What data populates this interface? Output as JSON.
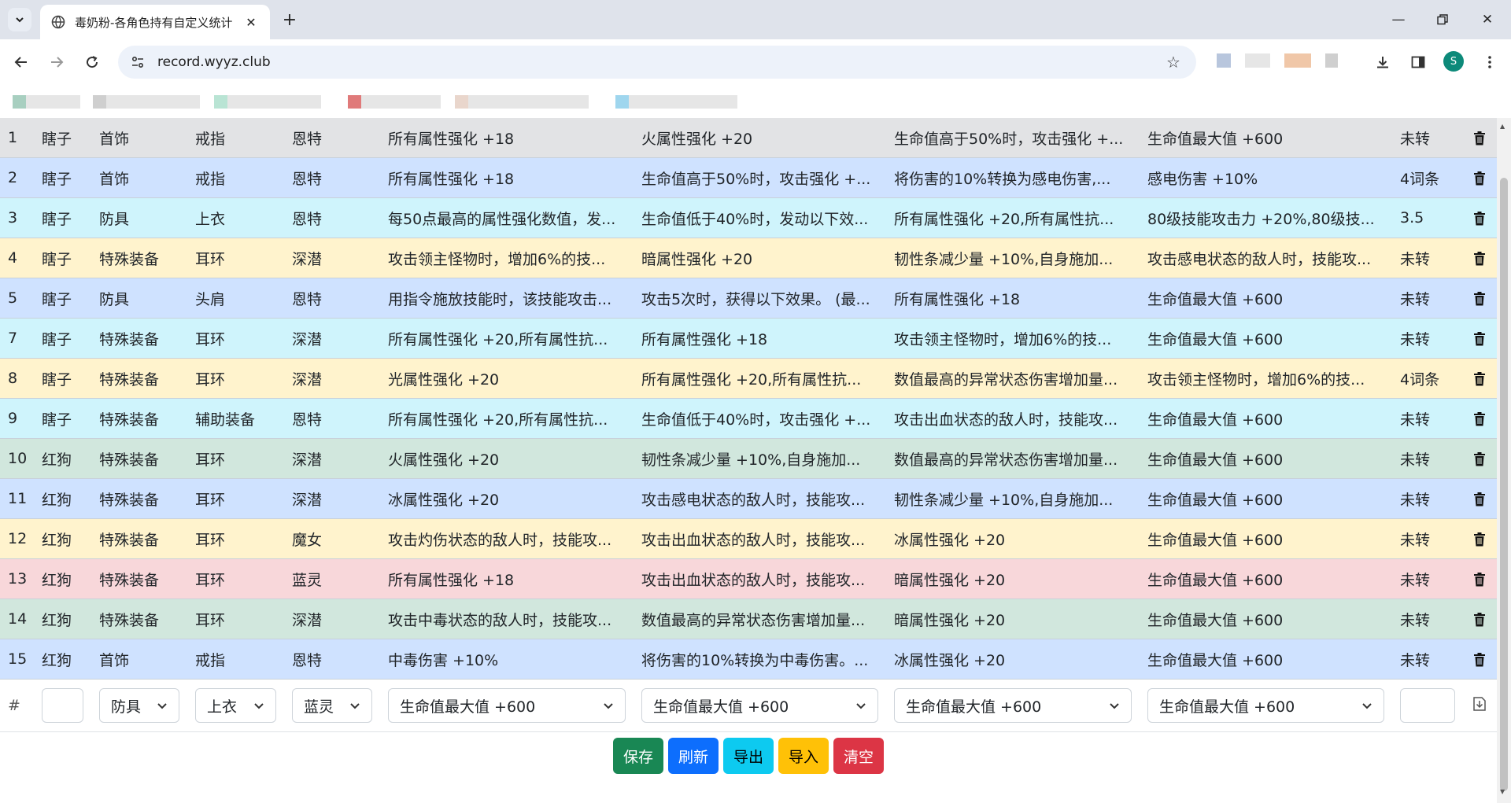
{
  "browser": {
    "tab_title": "毒奶粉-各角色持有自定义统计",
    "url": "record.wyyz.club",
    "profile_initial": "S"
  },
  "colors": {
    "gray": "#e2e3e5",
    "blue": "#cfe2ff",
    "cyan": "#cff4fc",
    "yellow": "#fff3cd",
    "green": "#d1e7dd",
    "red": "#f8d7da",
    "btn_save": "#198754",
    "btn_refresh": "#0d6efd",
    "btn_export": "#0dcaf0",
    "btn_import": "#ffc107",
    "btn_clear": "#dc3545"
  },
  "table": {
    "rows": [
      {
        "id": "1",
        "role": "瞎子",
        "type": "首饰",
        "slot": "戒指",
        "set": "恩特",
        "a1": "所有属性强化 +18",
        "a2": "火属性强化 +20",
        "a3": "生命值高于50%时，攻击强化 +...",
        "a4": "生命值最大值 +600",
        "status": "未转",
        "color": "gray"
      },
      {
        "id": "2",
        "role": "瞎子",
        "type": "首饰",
        "slot": "戒指",
        "set": "恩特",
        "a1": "所有属性强化 +18",
        "a2": "生命值高于50%时，攻击强化 +...",
        "a3": "将伤害的10%转换为感电伤害,...",
        "a4": "感电伤害 +10%",
        "status": "4词条",
        "color": "blue"
      },
      {
        "id": "3",
        "role": "瞎子",
        "type": "防具",
        "slot": "上衣",
        "set": "恩特",
        "a1": "每50点最高的属性强化数值，发...",
        "a2": "生命值低于40%时，发动以下效...",
        "a3": "所有属性强化 +20,所有属性抗...",
        "a4": "80级技能攻击力 +20%,80级技...",
        "status": "3.5",
        "color": "cyan"
      },
      {
        "id": "4",
        "role": "瞎子",
        "type": "特殊装备",
        "slot": "耳环",
        "set": "深潜",
        "a1": "攻击领主怪物时，增加6%的技...",
        "a2": "暗属性强化 +20",
        "a3": "韧性条减少量 +10%,自身施加...",
        "a4": "攻击感电状态的敌人时，技能攻...",
        "status": "未转",
        "color": "yellow"
      },
      {
        "id": "5",
        "role": "瞎子",
        "type": "防具",
        "slot": "头肩",
        "set": "恩特",
        "a1": "用指令施放技能时，该技能攻击...",
        "a2": "攻击5次时，获得以下效果。 (最...",
        "a3": "所有属性强化 +18",
        "a4": "生命值最大值 +600",
        "status": "未转",
        "color": "blue"
      },
      {
        "id": "7",
        "role": "瞎子",
        "type": "特殊装备",
        "slot": "耳环",
        "set": "深潜",
        "a1": "所有属性强化 +20,所有属性抗...",
        "a2": "所有属性强化 +18",
        "a3": "攻击领主怪物时，增加6%的技...",
        "a4": "生命值最大值 +600",
        "status": "未转",
        "color": "cyan"
      },
      {
        "id": "8",
        "role": "瞎子",
        "type": "特殊装备",
        "slot": "耳环",
        "set": "深潜",
        "a1": "光属性强化 +20",
        "a2": "所有属性强化 +20,所有属性抗...",
        "a3": "数值最高的异常状态伤害增加量...",
        "a4": "攻击领主怪物时，增加6%的技...",
        "status": "4词条",
        "color": "yellow"
      },
      {
        "id": "9",
        "role": "瞎子",
        "type": "特殊装备",
        "slot": "辅助装备",
        "set": "恩特",
        "a1": "所有属性强化 +20,所有属性抗...",
        "a2": "生命值低于40%时，攻击强化 +...",
        "a3": "攻击出血状态的敌人时，技能攻...",
        "a4": "生命值最大值 +600",
        "status": "未转",
        "color": "cyan"
      },
      {
        "id": "10",
        "role": "红狗",
        "type": "特殊装备",
        "slot": "耳环",
        "set": "深潜",
        "a1": "火属性强化 +20",
        "a2": "韧性条减少量 +10%,自身施加...",
        "a3": "数值最高的异常状态伤害增加量...",
        "a4": "生命值最大值 +600",
        "status": "未转",
        "color": "green"
      },
      {
        "id": "11",
        "role": "红狗",
        "type": "特殊装备",
        "slot": "耳环",
        "set": "深潜",
        "a1": "冰属性强化 +20",
        "a2": "攻击感电状态的敌人时，技能攻...",
        "a3": "韧性条减少量 +10%,自身施加...",
        "a4": "生命值最大值 +600",
        "status": "未转",
        "color": "blue"
      },
      {
        "id": "12",
        "role": "红狗",
        "type": "特殊装备",
        "slot": "耳环",
        "set": "魔女",
        "a1": "攻击灼伤状态的敌人时，技能攻...",
        "a2": "攻击出血状态的敌人时，技能攻...",
        "a3": "冰属性强化 +20",
        "a4": "生命值最大值 +600",
        "status": "未转",
        "color": "yellow"
      },
      {
        "id": "13",
        "role": "红狗",
        "type": "特殊装备",
        "slot": "耳环",
        "set": "蓝灵",
        "a1": "所有属性强化 +18",
        "a2": "攻击出血状态的敌人时，技能攻...",
        "a3": "暗属性强化 +20",
        "a4": "生命值最大值 +600",
        "status": "未转",
        "color": "red"
      },
      {
        "id": "14",
        "role": "红狗",
        "type": "特殊装备",
        "slot": "耳环",
        "set": "深潜",
        "a1": "攻击中毒状态的敌人时，技能攻...",
        "a2": "数值最高的异常状态伤害增加量...",
        "a3": "暗属性强化 +20",
        "a4": "生命值最大值 +600",
        "status": "未转",
        "color": "green"
      },
      {
        "id": "15",
        "role": "红狗",
        "type": "首饰",
        "slot": "戒指",
        "set": "恩特",
        "a1": "中毒伤害 +10%",
        "a2": "将伤害的10%转换为中毒伤害。...",
        "a3": "冰属性强化 +20",
        "a4": "生命值最大值 +600",
        "status": "未转",
        "color": "blue"
      }
    ]
  },
  "form": {
    "hash": "#",
    "type": "防具",
    "slot": "上衣",
    "set": "蓝灵",
    "a1": "生命值最大值 +600",
    "a2": "生命值最大值 +600",
    "a3": "生命值最大值 +600",
    "a4": "生命值最大值 +600"
  },
  "buttons": {
    "save": "保存",
    "refresh": "刷新",
    "export": "导出",
    "import": "导入",
    "clear": "清空"
  }
}
